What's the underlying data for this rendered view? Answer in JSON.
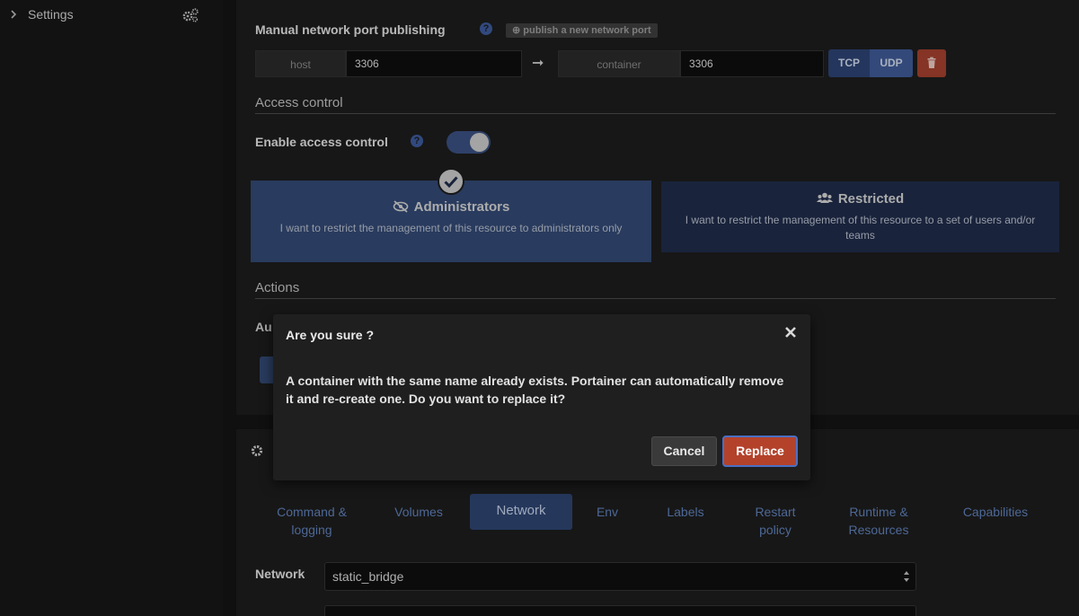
{
  "sidebar": {
    "settings_label": "Settings"
  },
  "ports": {
    "title": "Manual network port publishing",
    "publish_button": "publish a new network port",
    "host_addon": "host",
    "host_value": "3306",
    "container_addon": "container",
    "container_value": "3306",
    "tcp_label": "TCP",
    "udp_label": "UDP"
  },
  "access": {
    "section_title": "Access control",
    "enable_label": "Enable access control",
    "enabled": true,
    "admin_title": "Administrators",
    "admin_desc": "I want to restrict the management of this resource to administrators only",
    "restricted_title": "Restricted",
    "restricted_desc": "I want to restrict the management of this resource to a set of users and/or teams"
  },
  "actions": {
    "section_title": "Actions"
  },
  "modal": {
    "title": "Are you sure ?",
    "body": "A container with the same name already exists. Portainer can automatically remove it and re-create one. Do you want to replace it?",
    "cancel_label": "Cancel",
    "replace_label": "Replace"
  },
  "tabs": [
    {
      "label": "Command & logging"
    },
    {
      "label": "Volumes"
    },
    {
      "label": "Network"
    },
    {
      "label": "Env"
    },
    {
      "label": "Labels"
    },
    {
      "label": "Restart policy"
    },
    {
      "label": "Runtime & Resources"
    },
    {
      "label": "Capabilities"
    }
  ],
  "network": {
    "label": "Network",
    "selected": "static_bridge"
  },
  "colors": {
    "accent": "#3f5a95",
    "danger": "#a3402e",
    "focus": "#4a6fc4"
  }
}
